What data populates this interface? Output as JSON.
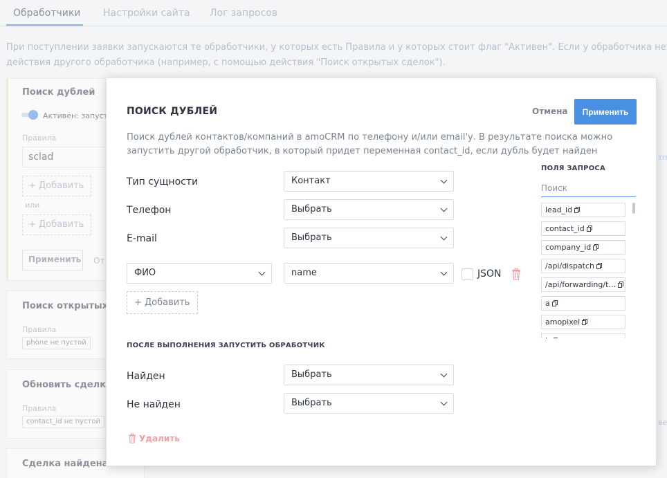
{
  "tabs": [
    {
      "label": "Обработчики",
      "active": true
    },
    {
      "label": "Настройки сайта",
      "active": false
    },
    {
      "label": "Лог запросов",
      "active": false
    }
  ],
  "intro": "При поступлении заявки запускаются те обработчики, у которых есть Правила и у которых стоит флаг \"Активен\". Если у обработчика нет Пр действия другого обработчика (например, с помощью действия \"Поиск открытых сделок\").",
  "background": {
    "card1": {
      "title": "Поиск дублей",
      "toggle_label": "Активен: запусти",
      "rules_label": "Правила",
      "rule_value": "sclad",
      "add_label": "+ Добавить",
      "or_label": "или",
      "apply_label": "Применить",
      "other_label": "От"
    },
    "card2": {
      "title": "Поиск открытых сд",
      "rules_label": "Правила",
      "tag": "phone не пустой"
    },
    "card3": {
      "title": "Обновить сделку и",
      "rules_label": "Правила",
      "tag": "contact_id не пустой"
    },
    "card4": {
      "title": "Сделка найдена"
    },
    "right_frags": [
      "тпр",
      "вен"
    ]
  },
  "modal": {
    "title": "ПОИСК ДУБЛЕЙ",
    "cancel_label": "Отмена",
    "apply_label": "Применить",
    "description": "Поиск дублей контактов/компаний в amoCRM по телефону и/или email'у. В результате поиска можно запустить другой обработчик, в который придет переменная contact_id, если дубль будет найден",
    "entity_type": {
      "label": "Тип сущности",
      "value": "Контакт"
    },
    "phone": {
      "label": "Телефон",
      "value": "Выбрать"
    },
    "email": {
      "label": "E-mail",
      "value": "Выбрать"
    },
    "custom_field": {
      "name": "ФИО",
      "value": "name",
      "json_label": "JSON",
      "json_checked": false
    },
    "add_label": "+ Добавить",
    "after_section": "ПОСЛЕ ВЫПОЛНЕНИЯ ЗАПУСТИТЬ ОБРАБОТЧИК",
    "found": {
      "label": "Найден",
      "value": "Выбрать"
    },
    "not_found": {
      "label": "Не найден",
      "value": "Выбрать"
    },
    "delete_label": "Удалить",
    "query_fields": {
      "title": "ПОЛЯ ЗАПРОСА",
      "search_placeholder": "Поиск",
      "items": [
        "lead_id",
        "contact_id",
        "company_id",
        "/api/dispatch",
        "/api/forwarding/t…",
        "a",
        "amopixel",
        "b"
      ]
    }
  },
  "colors": {
    "accent": "#4a90e2",
    "danger": "#f0a0a0"
  }
}
